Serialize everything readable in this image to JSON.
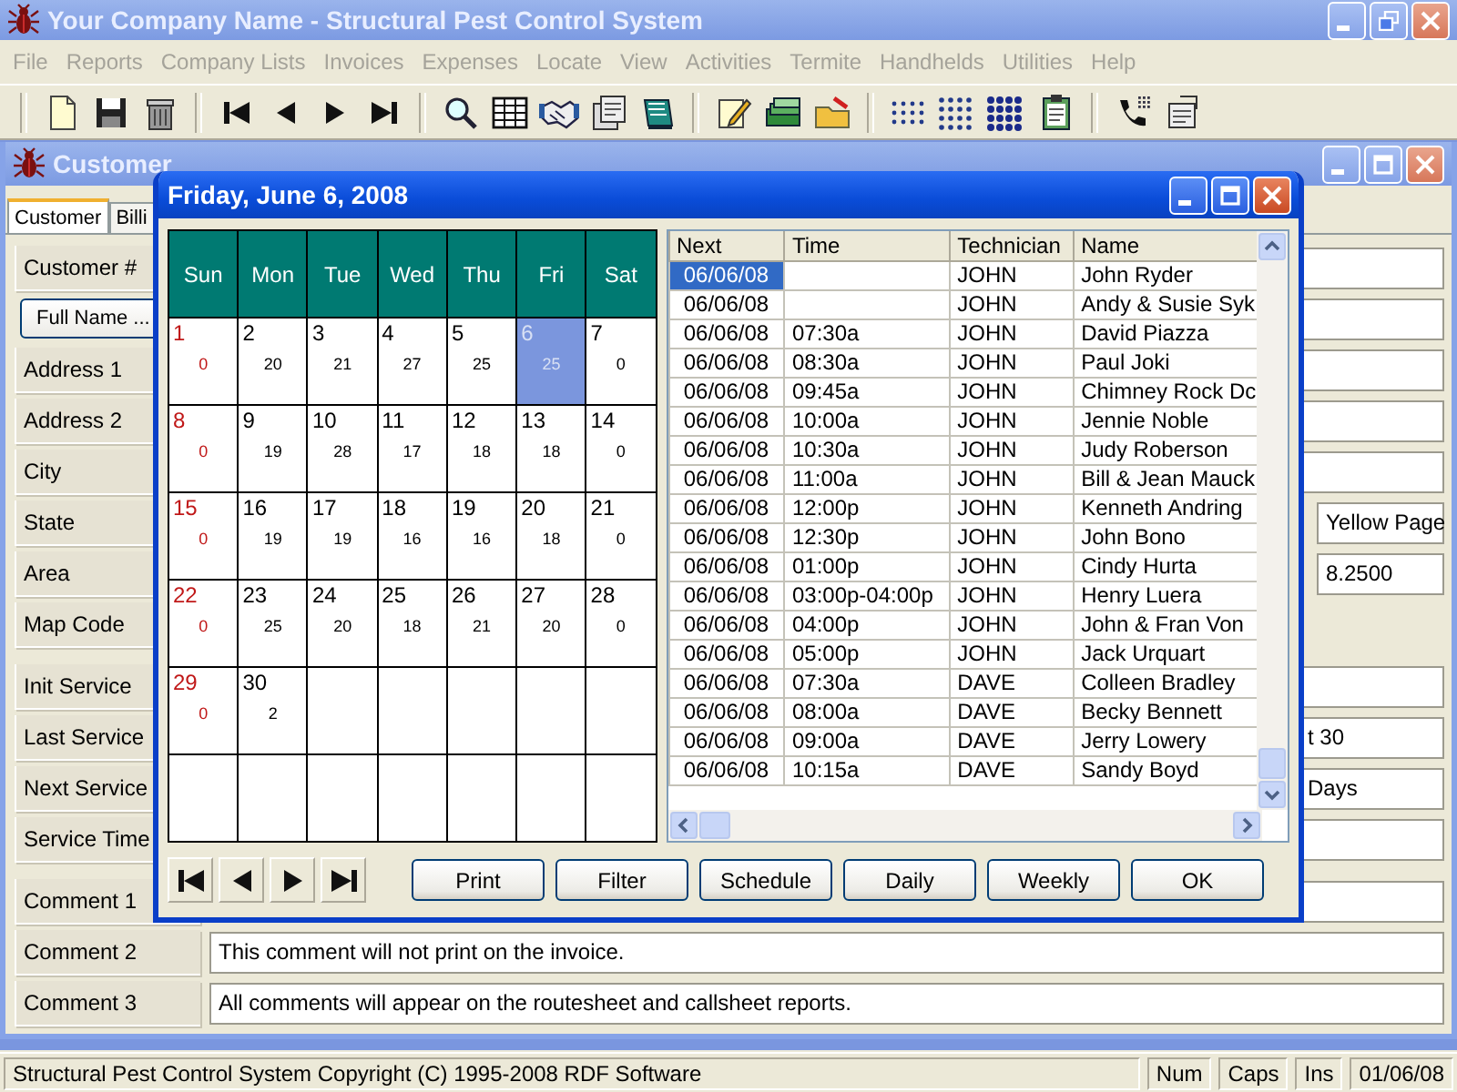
{
  "app": {
    "title": "Your Company Name - Structural Pest Control System"
  },
  "menu": [
    {
      "label": "File",
      "disabled": true
    },
    {
      "label": "Reports",
      "disabled": true
    },
    {
      "label": "Company Lists",
      "disabled": true
    },
    {
      "label": "Invoices",
      "disabled": true
    },
    {
      "label": "Expenses",
      "disabled": true
    },
    {
      "label": "Locate",
      "disabled": true
    },
    {
      "label": "View",
      "disabled": true
    },
    {
      "label": "Activities",
      "disabled": true
    },
    {
      "label": "Termite",
      "disabled": true
    },
    {
      "label": "Handhelds",
      "disabled": true
    },
    {
      "label": "Utilities",
      "disabled": true
    },
    {
      "label": "Help",
      "disabled": true
    }
  ],
  "customers": {
    "title": "Customer",
    "tabs": [
      {
        "label": "Customer",
        "selected": true
      },
      {
        "label": "Billi",
        "selected": false
      }
    ],
    "sections": [
      {
        "rows": [
          {
            "label": "Customer #",
            "kind": "label",
            "field": {
              "kind": "wide"
            }
          },
          {
            "label": "Full Name ...",
            "kind": "button",
            "field": {
              "kind": "wide"
            }
          },
          {
            "label": "Address 1",
            "kind": "label",
            "field": {
              "kind": "wide"
            }
          },
          {
            "label": "Address 2",
            "kind": "label",
            "field": {
              "kind": "wide"
            }
          },
          {
            "label": "City",
            "kind": "label",
            "field": {
              "kind": "wide"
            }
          },
          {
            "label": "State",
            "kind": "label",
            "field": {
              "kind": "short",
              "value": "Yellow Page"
            }
          },
          {
            "label": "Area",
            "kind": "label",
            "field": {
              "kind": "short",
              "value": "8.2500"
            }
          },
          {
            "label": "Map Code",
            "kind": "label"
          }
        ]
      },
      {
        "rows": [
          {
            "label": "Init Service",
            "kind": "label",
            "field": {
              "kind": "wide"
            }
          },
          {
            "label": "Last Service",
            "kind": "label",
            "field": {
              "kind": "hidden_start",
              "value": "t 30"
            }
          },
          {
            "label": "Next Service",
            "kind": "label",
            "field": {
              "kind": "hidden_start",
              "value": "Days"
            }
          },
          {
            "label": "Service Time",
            "kind": "label",
            "field": {
              "kind": "wide"
            }
          }
        ]
      },
      {
        "rows": [
          {
            "label": "Comment 1",
            "kind": "label",
            "field": {
              "kind": "wide"
            }
          },
          {
            "label": "Comment 2",
            "kind": "label",
            "field": {
              "kind": "wide",
              "value": "This comment will not print on the invoice."
            }
          },
          {
            "label": "Comment 3",
            "kind": "label",
            "field": {
              "kind": "wide",
              "value": "All comments will appear on the routesheet and callsheet reports."
            }
          }
        ]
      }
    ]
  },
  "dialog": {
    "title": "Friday, June 6,  2008",
    "calendar": {
      "weekdays": [
        "Sun",
        "Mon",
        "Tue",
        "Wed",
        "Thu",
        "Fri",
        "Sat"
      ],
      "weeks": [
        [
          {
            "day": "1",
            "count": "0",
            "selected": false
          },
          {
            "day": "2",
            "count": "20",
            "selected": false
          },
          {
            "day": "3",
            "count": "21",
            "selected": false
          },
          {
            "day": "4",
            "count": "27",
            "selected": false
          },
          {
            "day": "5",
            "count": "25",
            "selected": false
          },
          {
            "day": "6",
            "count": "25",
            "selected": true
          },
          {
            "day": "7",
            "count": "0",
            "selected": false
          }
        ],
        [
          {
            "day": "8",
            "count": "0",
            "selected": false
          },
          {
            "day": "9",
            "count": "19",
            "selected": false
          },
          {
            "day": "10",
            "count": "28",
            "selected": false
          },
          {
            "day": "11",
            "count": "17",
            "selected": false
          },
          {
            "day": "12",
            "count": "18",
            "selected": false
          },
          {
            "day": "13",
            "count": "18",
            "selected": false
          },
          {
            "day": "14",
            "count": "0",
            "selected": false
          }
        ],
        [
          {
            "day": "15",
            "count": "0",
            "selected": false
          },
          {
            "day": "16",
            "count": "19",
            "selected": false
          },
          {
            "day": "17",
            "count": "19",
            "selected": false
          },
          {
            "day": "18",
            "count": "16",
            "selected": false
          },
          {
            "day": "19",
            "count": "16",
            "selected": false
          },
          {
            "day": "20",
            "count": "18",
            "selected": false
          },
          {
            "day": "21",
            "count": "0",
            "selected": false
          }
        ],
        [
          {
            "day": "22",
            "count": "0",
            "selected": false
          },
          {
            "day": "23",
            "count": "25",
            "selected": false
          },
          {
            "day": "24",
            "count": "20",
            "selected": false
          },
          {
            "day": "25",
            "count": "18",
            "selected": false
          },
          {
            "day": "26",
            "count": "21",
            "selected": false
          },
          {
            "day": "27",
            "count": "20",
            "selected": false
          },
          {
            "day": "28",
            "count": "0",
            "selected": false
          }
        ],
        [
          {
            "day": "29",
            "count": "0",
            "selected": false
          },
          {
            "day": "30",
            "count": "2",
            "selected": false
          }
        ]
      ]
    },
    "schedule": {
      "columns": [
        "Next",
        "Time",
        "Technician",
        "Name"
      ],
      "rows": [
        {
          "next": "06/06/08",
          "technician": "JOHN",
          "name": "John Ryder",
          "selected": true
        },
        {
          "next": "06/06/08",
          "technician": "JOHN",
          "name": "Andy  & Susie Syk",
          "selected": false
        },
        {
          "next": "06/06/08",
          "time": "07:30a",
          "technician": "JOHN",
          "name": "David Piazza",
          "selected": false
        },
        {
          "next": "06/06/08",
          "time": "08:30a",
          "technician": "JOHN",
          "name": "Paul Joki",
          "selected": false
        },
        {
          "next": "06/06/08",
          "time": "09:45a",
          "technician": "JOHN",
          "name": "Chimney Rock Dc",
          "selected": false
        },
        {
          "next": "06/06/08",
          "time": "10:00a",
          "technician": "JOHN",
          "name": "Jennie Noble",
          "selected": false
        },
        {
          "next": "06/06/08",
          "time": "10:30a",
          "technician": "JOHN",
          "name": "Judy Roberson",
          "selected": false
        },
        {
          "next": "06/06/08",
          "time": "11:00a",
          "technician": "JOHN",
          "name": "Bill & Jean Mauck",
          "selected": false
        },
        {
          "next": "06/06/08",
          "time": "12:00p",
          "technician": "JOHN",
          "name": "Kenneth Andring",
          "selected": false
        },
        {
          "next": "06/06/08",
          "time": "12:30p",
          "technician": "JOHN",
          "name": "John Bono",
          "selected": false
        },
        {
          "next": "06/06/08",
          "time": "01:00p",
          "technician": "JOHN",
          "name": "Cindy Hurta",
          "selected": false
        },
        {
          "next": "06/06/08",
          "time": "03:00p-04:00p",
          "technician": "JOHN",
          "name": "Henry Luera",
          "selected": false
        },
        {
          "next": "06/06/08",
          "time": "04:00p",
          "technician": "JOHN",
          "name": "John & Fran Von",
          "selected": false
        },
        {
          "next": "06/06/08",
          "time": "05:00p",
          "technician": "JOHN",
          "name": "Jack Urquart",
          "selected": false
        },
        {
          "next": "06/06/08",
          "time": "07:30a",
          "technician": "DAVE",
          "name": "Colleen Bradley",
          "selected": false
        },
        {
          "next": "06/06/08",
          "time": "08:00a",
          "technician": "DAVE",
          "name": "Becky Bennett",
          "selected": false
        },
        {
          "next": "06/06/08",
          "time": "09:00a",
          "technician": "DAVE",
          "name": "Jerry Lowery",
          "selected": false
        },
        {
          "next": "06/06/08",
          "time": "10:15a",
          "technician": "DAVE",
          "name": "Sandy Boyd",
          "selected": false
        }
      ]
    },
    "buttons": [
      "Print",
      "Filter",
      "Schedule",
      "Daily",
      "Weekly",
      "OK"
    ]
  },
  "status_bar": {
    "text": "Structural Pest Control System  Copyright (C) 1995-2008 RDF Software",
    "panels": [
      "Num",
      "Caps",
      "Ins",
      "01/06/08"
    ]
  }
}
